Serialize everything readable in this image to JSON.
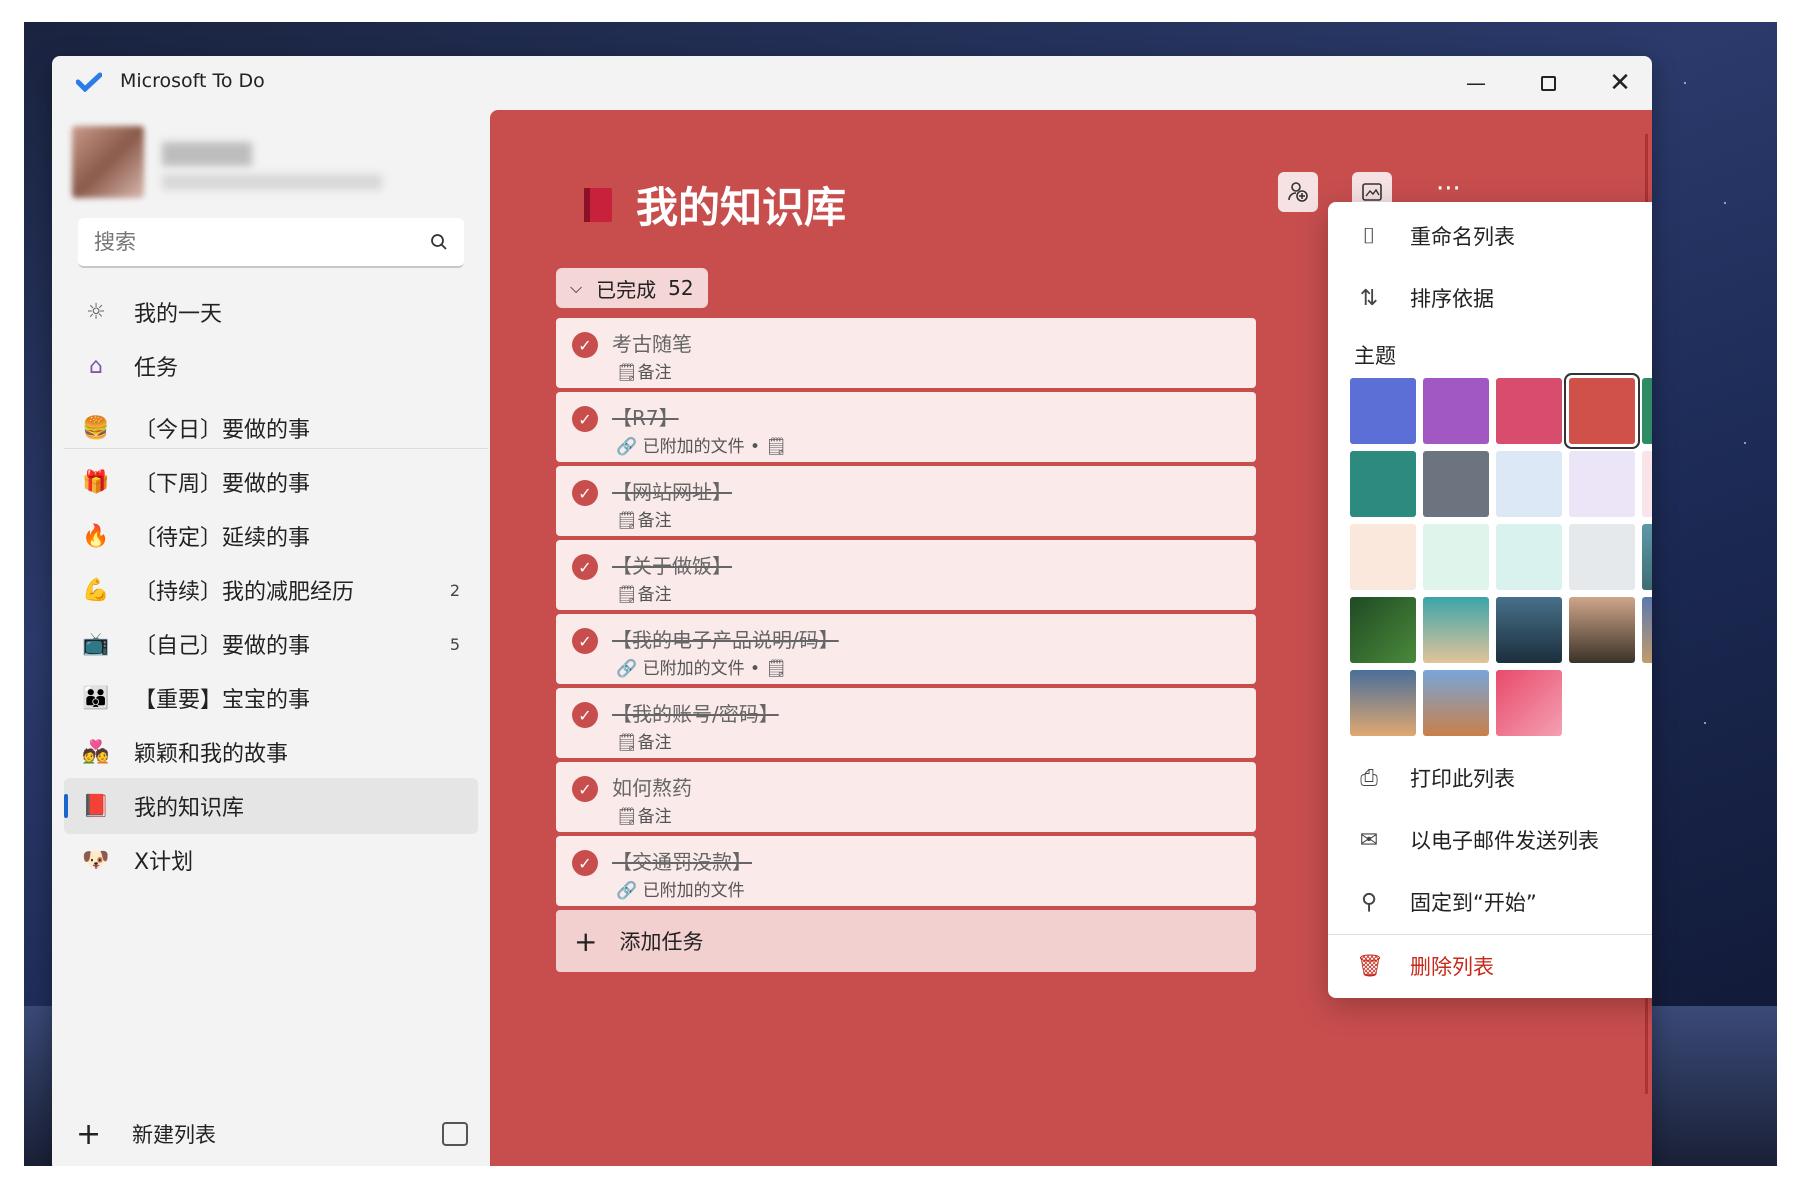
{
  "app": {
    "title": "Microsoft To Do"
  },
  "search": {
    "placeholder": "搜索"
  },
  "sidebar": {
    "smart_lists": [
      {
        "icon": "sun-icon",
        "label": "我的一天"
      },
      {
        "icon": "home-icon",
        "label": "任务"
      }
    ],
    "lists": [
      {
        "emoji": "🍔",
        "label": "〔今日〕要做的事",
        "count": ""
      },
      {
        "emoji": "🎁",
        "label": "〔下周〕要做的事",
        "count": ""
      },
      {
        "emoji": "🔥",
        "label": "〔待定〕延续的事",
        "count": ""
      },
      {
        "emoji": "💪",
        "label": "〔持续〕我的减肥经历",
        "count": "2"
      },
      {
        "emoji": "📺",
        "label": "〔自己〕要做的事",
        "count": "5"
      },
      {
        "emoji": "👪",
        "label": "【重要】宝宝的事",
        "count": ""
      },
      {
        "emoji": "💑",
        "label": "颖颖和我的故事",
        "count": ""
      },
      {
        "emoji": "📕",
        "label": "我的知识库",
        "count": "",
        "active": true
      },
      {
        "emoji": "🐶",
        "label": "X计划",
        "count": ""
      }
    ],
    "new_list": "新建列表"
  },
  "main": {
    "title": "我的知识库",
    "completed_label": "已完成",
    "completed_count": "52",
    "tasks": [
      {
        "title": "考古随笔",
        "strike": false,
        "meta": "🗒备注"
      },
      {
        "title": "【R7】",
        "strike": true,
        "meta": "🔗 已附加的文件 • 🗒"
      },
      {
        "title": "【网站网址】",
        "strike": true,
        "meta": "🗒备注"
      },
      {
        "title": "【关于做饭】",
        "strike": true,
        "meta": "🗒备注"
      },
      {
        "title": "【我的电子产品说明/码】",
        "strike": true,
        "meta": "🔗 已附加的文件 • 🗒"
      },
      {
        "title": "【我的账号/密码】",
        "strike": true,
        "meta": "🗒备注"
      },
      {
        "title": "如何熬药",
        "strike": false,
        "meta": "🗒备注"
      },
      {
        "title": "【交通罚没款】",
        "strike": true,
        "meta": "🔗 已附加的文件"
      }
    ],
    "add_task": "添加任务"
  },
  "menu": {
    "rename": "重命名列表",
    "sort": "排序依据",
    "theme_label": "主题",
    "themes": [
      {
        "color": "#5b6fd6",
        "selected": false
      },
      {
        "color": "#a258c2",
        "selected": false
      },
      {
        "color": "#d84c6e",
        "selected": false
      },
      {
        "color": "#d0504a",
        "selected": true
      },
      {
        "color": "#2e8b63",
        "selected": false
      },
      {
        "color": "#2d8a7e",
        "selected": false
      },
      {
        "color": "#6c7480",
        "selected": false
      },
      {
        "color": "#dce8f6",
        "selected": false
      },
      {
        "color": "#ece4f7",
        "selected": false
      },
      {
        "color": "#f9e4ea",
        "selected": false
      },
      {
        "color": "#fbe8dc",
        "selected": false
      },
      {
        "color": "#dff4ea",
        "selected": false
      },
      {
        "color": "#d9f2ee",
        "selected": false
      },
      {
        "color": "#e6e9ec",
        "selected": false
      },
      {
        "color": "linear-gradient(180deg,#5d98a8,#3e6d72)",
        "selected": false
      },
      {
        "color": "linear-gradient(135deg,#1f4a24,#4a8a3a)",
        "selected": false
      },
      {
        "color": "linear-gradient(180deg,#3ba5a8,#e2c49a)",
        "selected": false
      },
      {
        "color": "linear-gradient(180deg,#47708a,#1c2f3c)",
        "selected": false
      },
      {
        "color": "linear-gradient(180deg,#cfa58a,#3b3328)",
        "selected": false
      },
      {
        "color": "linear-gradient(180deg,#5b7ab0,#c39a6c)",
        "selected": false
      },
      {
        "color": "linear-gradient(180deg,#4a6f9a,#e0a870)",
        "selected": false
      },
      {
        "color": "linear-gradient(180deg,#78a6d8,#c9804a)",
        "selected": false
      },
      {
        "color": "linear-gradient(135deg,#e84a6a,#f4a0b4)",
        "selected": false
      }
    ],
    "print": "打印此列表",
    "email": "以电子邮件发送列表",
    "pin": "固定到“开始”",
    "delete": "删除列表"
  }
}
